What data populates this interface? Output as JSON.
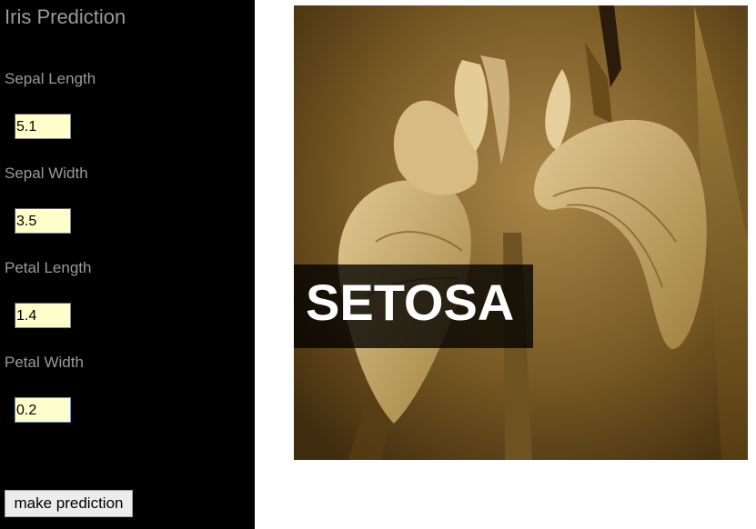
{
  "app": {
    "title": "Iris Prediction"
  },
  "fields": [
    {
      "label": "Sepal Length",
      "value": "5.1"
    },
    {
      "label": "Sepal Width",
      "value": "3.5"
    },
    {
      "label": "Petal Length",
      "value": "1.4"
    },
    {
      "label": "Petal Width",
      "value": "0.2"
    }
  ],
  "actions": {
    "predict_label": "make prediction"
  },
  "result": {
    "label": "SETOSA",
    "image": "iris-flower-photo"
  },
  "colors": {
    "sidebar_bg": "#000000",
    "label_text": "#9a9a9a",
    "input_bg": "#ffffcc",
    "photo_tone": "#6b4f1d"
  }
}
